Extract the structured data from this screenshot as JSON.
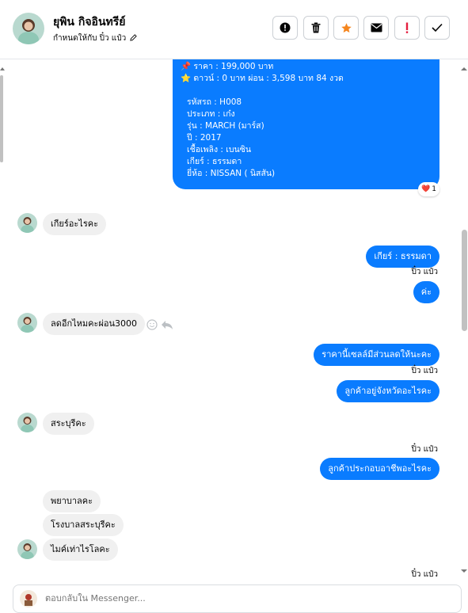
{
  "header": {
    "contact_name": "ยุพิน กิจอินทรีย์",
    "assigned_text": "กำหนดให้กับ ปิ๋ว แป๋ว",
    "actions": [
      {
        "name": "report-button",
        "icon": "exclamation-circle-icon"
      },
      {
        "name": "delete-button",
        "icon": "trash-icon"
      },
      {
        "name": "star-button",
        "icon": "star-icon",
        "color": "#f5861f"
      },
      {
        "name": "mail-button",
        "icon": "envelope-icon"
      },
      {
        "name": "spam-button",
        "icon": "exclamation-icon",
        "color": "#e41e3f"
      },
      {
        "name": "done-button",
        "icon": "check-icon"
      }
    ]
  },
  "card": {
    "lines": [
      "📌 ราคา : 199,000 บาท",
      "⭐ ดาวน์ : 0 บาท ผ่อน : 3,598 บาท 84 งวด",
      "",
      "รหัสรถ : H008",
      "ประเภท : เก๋ง",
      "รุ่น : MARCH (มาร์ส)",
      "ปี : 2017",
      "เชื้อเพลิง : เบนซิน",
      "เกียร์ : ธรรมดา",
      "ยี่ห้อ : NISSAN ( นิสสัน)"
    ],
    "reaction_emoji": "❤️",
    "reaction_count": "1"
  },
  "messages": {
    "in_1": "เกียร์อะไรคะ",
    "out_1": "เกียร์ : ธรรมดา",
    "sender_1": "ปิ๋ว แป๋ว",
    "out_2": "ค่ะ",
    "in_2": "ลดอีกไหมคะผ่อน3000",
    "out_3": "ราคานี้เซลล์มีส่วนลดให้นะคะ",
    "sender_2": "ปิ๋ว แป๋ว",
    "out_4": "ลูกค้าอยู่จังหวัดอะไรคะ",
    "in_3": "สระบุรีคะ",
    "sender_3": "ปิ๋ว แป๋ว",
    "out_5": "ลูกค้าประกอบอาชีพอะไรคะ",
    "in_4": "พยาบาลคะ",
    "in_5": "โรงบาลสระบุรีคะ",
    "in_6": "ไมค์เท่าไรโลคะ",
    "sender_4": "ปิ๋ว แป๋ว"
  },
  "composer": {
    "placeholder": "ตอบกลับใน Messenger..."
  },
  "colors": {
    "accent": "#0a7cff",
    "incoming": "#f0f0f0",
    "star": "#f5861f",
    "danger": "#e41e3f"
  }
}
